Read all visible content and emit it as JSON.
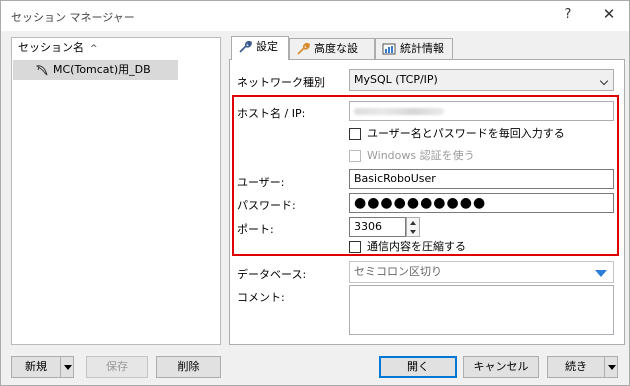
{
  "window": {
    "title": "セッション マネージャー",
    "help": "?",
    "close": "✕"
  },
  "tree": {
    "header": "セッション名",
    "sort_indicator": "^",
    "items": [
      {
        "label": "MC(Tomcat)用_DB"
      }
    ]
  },
  "left_buttons": {
    "new": "新規",
    "save": "保存",
    "delete": "削除"
  },
  "tabs": [
    {
      "label": "設定"
    },
    {
      "label": "高度な設定"
    },
    {
      "label": "統計情報"
    }
  ],
  "form": {
    "network_type_label": "ネットワーク種別",
    "network_type_value": "MySQL (TCP/IP)",
    "host_label": "ホスト名 / IP:",
    "host_value": "",
    "prompt_checkbox": "ユーザー名とパスワードを毎回入力する",
    "windows_auth_checkbox": "Windows 認証を使う",
    "user_label": "ユーザー:",
    "user_value": "BasicRoboUser",
    "password_label": "パスワード:",
    "password_value": "●●●●●●●●●●",
    "port_label": "ポート:",
    "port_value": "3306",
    "compress_checkbox": "通信内容を圧縮する",
    "database_label": "データベース:",
    "database_placeholder": "セミコロン区切り",
    "comment_label": "コメント:"
  },
  "bottom_buttons": {
    "open": "開く",
    "cancel": "キャンセル",
    "more": "続き"
  },
  "colors": {
    "highlight_border": "#e00000",
    "dropdown_arrow": "#2d7ed6"
  }
}
